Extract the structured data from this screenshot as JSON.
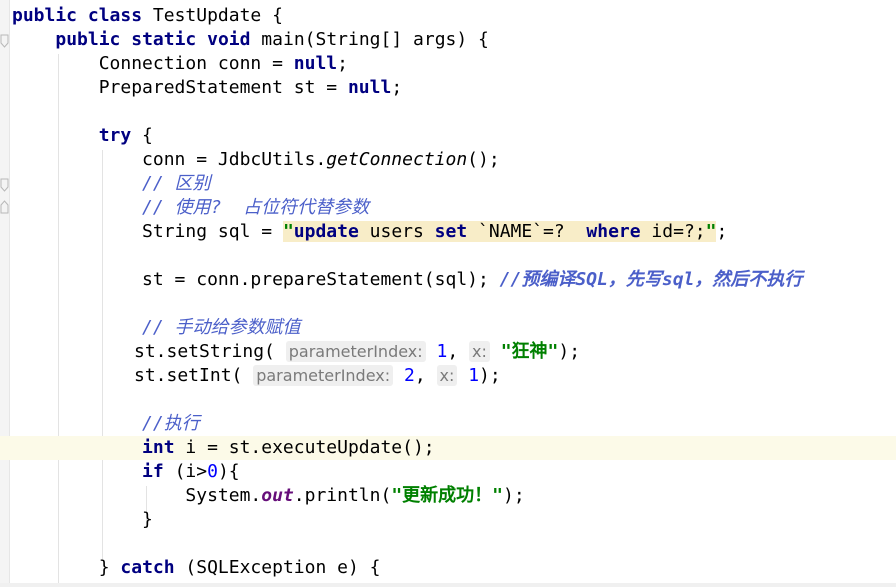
{
  "code": {
    "l1": {
      "kw1": "public",
      "kw2": "class",
      "name": " TestUpdate {"
    },
    "l2": {
      "kw1": "public",
      "kw2": "static",
      "kw3": "void",
      "rest": " main(String[] args) {"
    },
    "l3": {
      "pre": "Connection conn = ",
      "null": "null",
      "end": ";"
    },
    "l4": {
      "pre": "PreparedStatement st = ",
      "null": "null",
      "end": ";"
    },
    "l6": {
      "kw": "try",
      "rest": " {"
    },
    "l7": {
      "pre": "conn = JdbcUtils.",
      "method": "getConnection",
      "end": "();"
    },
    "l8": {
      "comment": "// 区别"
    },
    "l9": {
      "comment": "// 使用?  占位符代替参数"
    },
    "l10": {
      "pre": "String sql = ",
      "q1": "\"",
      "kw1": "update",
      "t1": " users ",
      "kw2": "set",
      "t2": " `NAME`=?  ",
      "kw3": "where",
      "t3": " id=?;",
      "q2": "\"",
      "end": ";"
    },
    "l12": {
      "code": "st = conn.prepareStatement(sql); ",
      "comment": "//预编译SQL，先写sql，然后不执行"
    },
    "l14": {
      "comment": "// 手动给参数赋值"
    },
    "l15": {
      "pre": "st.setString(",
      "hint1": "parameterIndex:",
      "num": "1",
      "mid": ", ",
      "hint2": "x:",
      "str": "\"狂神\"",
      "end": ");"
    },
    "l16": {
      "pre": "st.setInt(",
      "hint1": "parameterIndex:",
      "num1": "2",
      "mid": ", ",
      "hint2": "x:",
      "num2": "1",
      "end": ");"
    },
    "l18": {
      "comment": "//执行"
    },
    "l19": {
      "kw": "int",
      "rest": " i = st.executeUpdate();"
    },
    "l20": {
      "kw": "if",
      "pre": " (i>",
      "num": "0",
      "end": "){"
    },
    "l21": {
      "pre": "System.",
      "field": "out",
      "mid": ".println(",
      "str": "\"更新成功！\"",
      "end": ");"
    },
    "l22": {
      "text": "}"
    },
    "l24": {
      "pre": "} ",
      "kw": "catch",
      "rest": " (SQLException e) {"
    }
  }
}
